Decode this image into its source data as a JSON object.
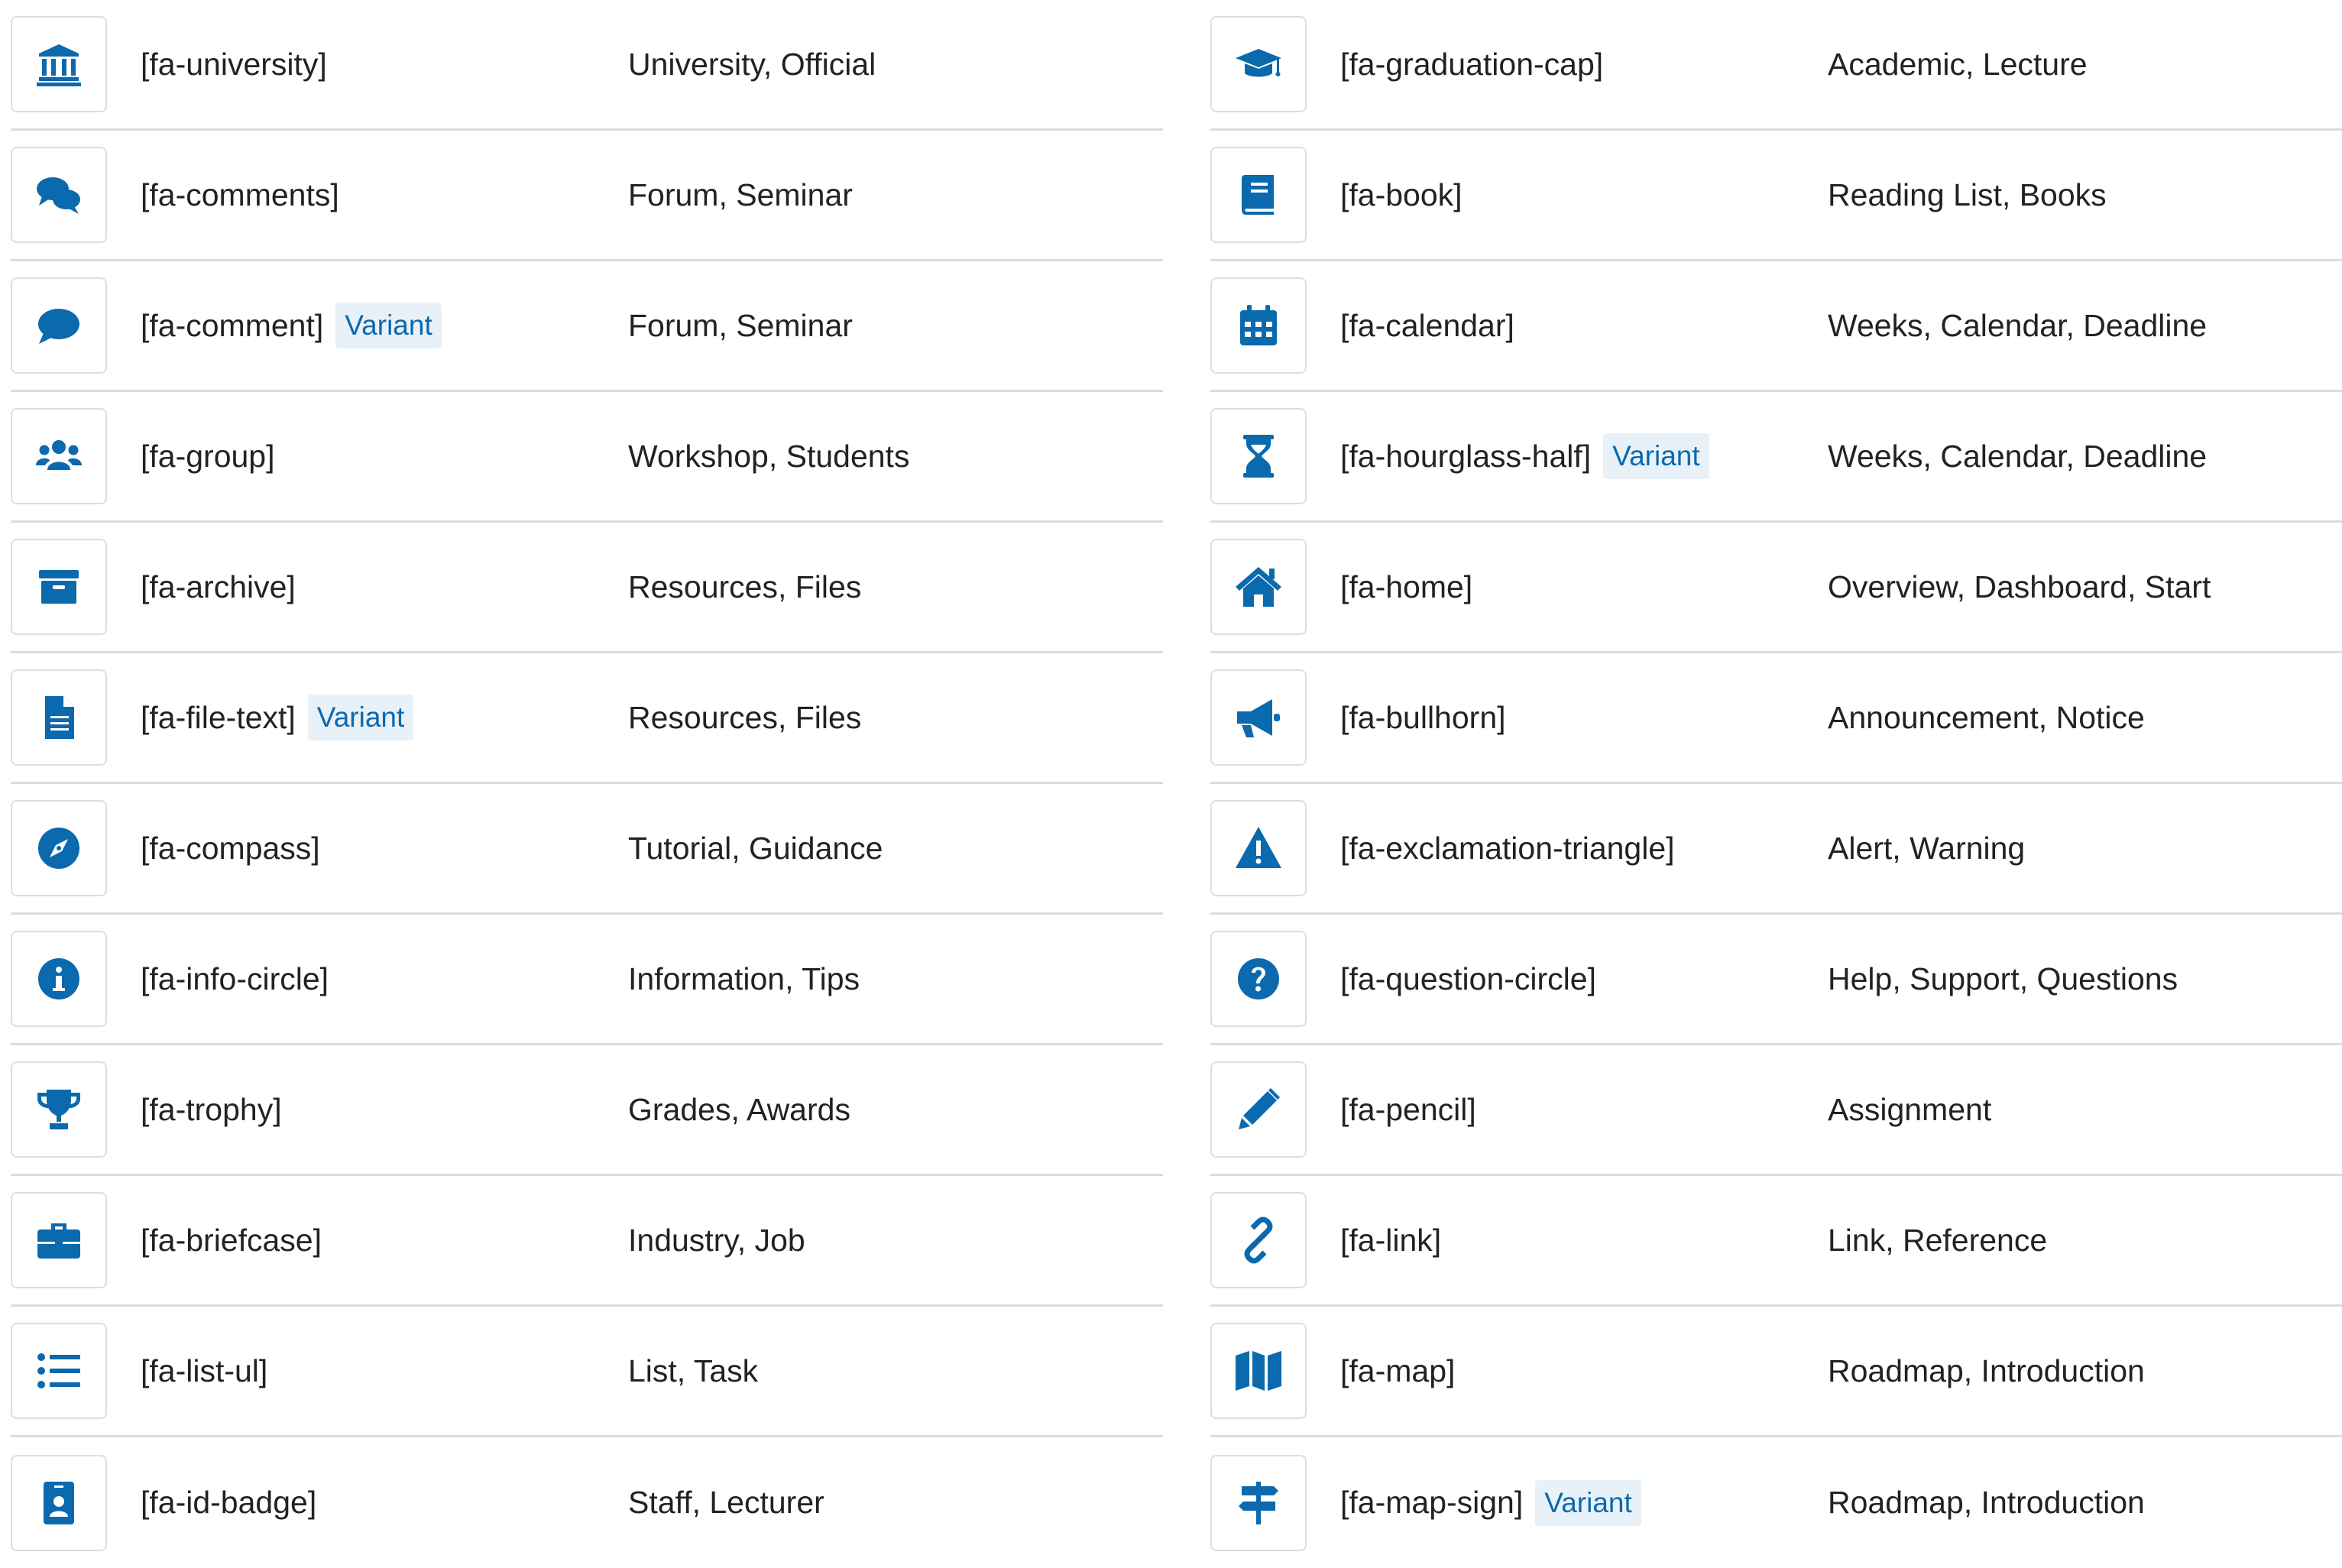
{
  "accent": "#0b69ad",
  "variant_label": "Variant",
  "left": [
    {
      "icon": "university-icon",
      "name": "[fa-university]",
      "desc": "University, Official",
      "variant": false
    },
    {
      "icon": "comments-icon",
      "name": "[fa-comments]",
      "desc": "Forum, Seminar",
      "variant": false
    },
    {
      "icon": "comment-icon",
      "name": "[fa-comment]",
      "desc": "Forum, Seminar",
      "variant": true
    },
    {
      "icon": "group-icon",
      "name": "[fa-group]",
      "desc": "Workshop, Students",
      "variant": false
    },
    {
      "icon": "archive-icon",
      "name": "[fa-archive]",
      "desc": "Resources, Files",
      "variant": false
    },
    {
      "icon": "file-text-icon",
      "name": "[fa-file-text]",
      "desc": "Resources, Files",
      "variant": true
    },
    {
      "icon": "compass-icon",
      "name": "[fa-compass]",
      "desc": "Tutorial, Guidance",
      "variant": false
    },
    {
      "icon": "info-circle-icon",
      "name": "[fa-info-circle]",
      "desc": "Information, Tips",
      "variant": false
    },
    {
      "icon": "trophy-icon",
      "name": "[fa-trophy]",
      "desc": "Grades, Awards",
      "variant": false
    },
    {
      "icon": "briefcase-icon",
      "name": "[fa-briefcase]",
      "desc": "Industry, Job",
      "variant": false
    },
    {
      "icon": "list-ul-icon",
      "name": "[fa-list-ul]",
      "desc": "List, Task",
      "variant": false
    },
    {
      "icon": "id-badge-icon",
      "name": "[fa-id-badge]",
      "desc": "Staff, Lecturer",
      "variant": false
    }
  ],
  "right": [
    {
      "icon": "graduation-cap-icon",
      "name": "[fa-graduation-cap]",
      "desc": "Academic, Lecture",
      "variant": false
    },
    {
      "icon": "book-icon",
      "name": "[fa-book]",
      "desc": "Reading List, Books",
      "variant": false
    },
    {
      "icon": "calendar-icon",
      "name": "[fa-calendar]",
      "desc": "Weeks, Calendar, Deadline",
      "variant": false
    },
    {
      "icon": "hourglass-half-icon",
      "name": "[fa-hourglass-half]",
      "desc": "Weeks, Calendar, Deadline",
      "variant": true
    },
    {
      "icon": "home-icon",
      "name": "[fa-home]",
      "desc": "Overview, Dashboard, Start",
      "variant": false
    },
    {
      "icon": "bullhorn-icon",
      "name": "[fa-bullhorn]",
      "desc": "Announcement, Notice",
      "variant": false
    },
    {
      "icon": "exclamation-triangle-icon",
      "name": "[fa-exclamation-triangle]",
      "desc": "Alert, Warning",
      "variant": false
    },
    {
      "icon": "question-circle-icon",
      "name": "[fa-question-circle]",
      "desc": "Help, Support, Questions",
      "variant": false
    },
    {
      "icon": "pencil-icon",
      "name": "[fa-pencil]",
      "desc": "Assignment",
      "variant": false
    },
    {
      "icon": "link-icon",
      "name": "[fa-link]",
      "desc": "Link, Reference",
      "variant": false
    },
    {
      "icon": "map-icon",
      "name": "[fa-map]",
      "desc": "Roadmap, Introduction",
      "variant": false
    },
    {
      "icon": "map-sign-icon",
      "name": "[fa-map-sign]",
      "desc": "Roadmap, Introduction",
      "variant": true
    }
  ]
}
